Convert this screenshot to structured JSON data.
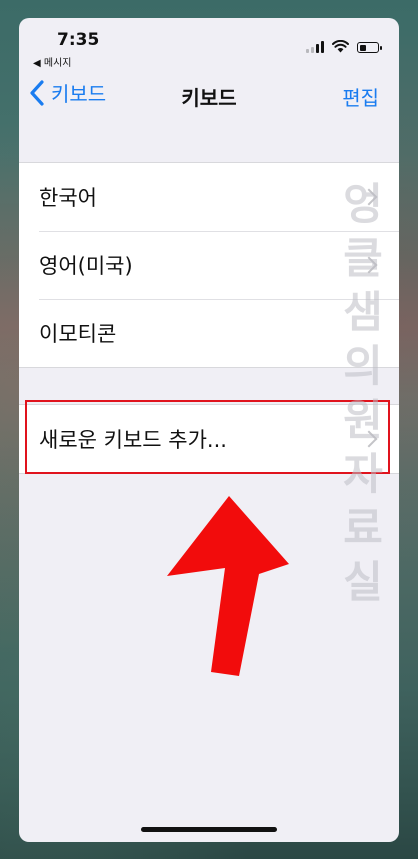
{
  "status_bar": {
    "time": "7:35",
    "back_app": "◀ 메시지"
  },
  "nav": {
    "back_label": "키보드",
    "title": "키보드",
    "edit_label": "편집"
  },
  "keyboards": [
    {
      "label": "한국어"
    },
    {
      "label": "영어(미국)"
    },
    {
      "label": "이모티콘"
    }
  ],
  "add_keyboard": {
    "label": "새로운 키보드 추가..."
  },
  "watermark": "엉클샘의 원자료실",
  "colors": {
    "accent": "#1a7cf0",
    "highlight": "#e0131d",
    "arrow": "#f20c0c"
  },
  "icons": [
    "back-chevron-icon",
    "cell-signal-icon",
    "wifi-icon",
    "battery-icon",
    "chevron-right-icon",
    "red-arrow"
  ]
}
